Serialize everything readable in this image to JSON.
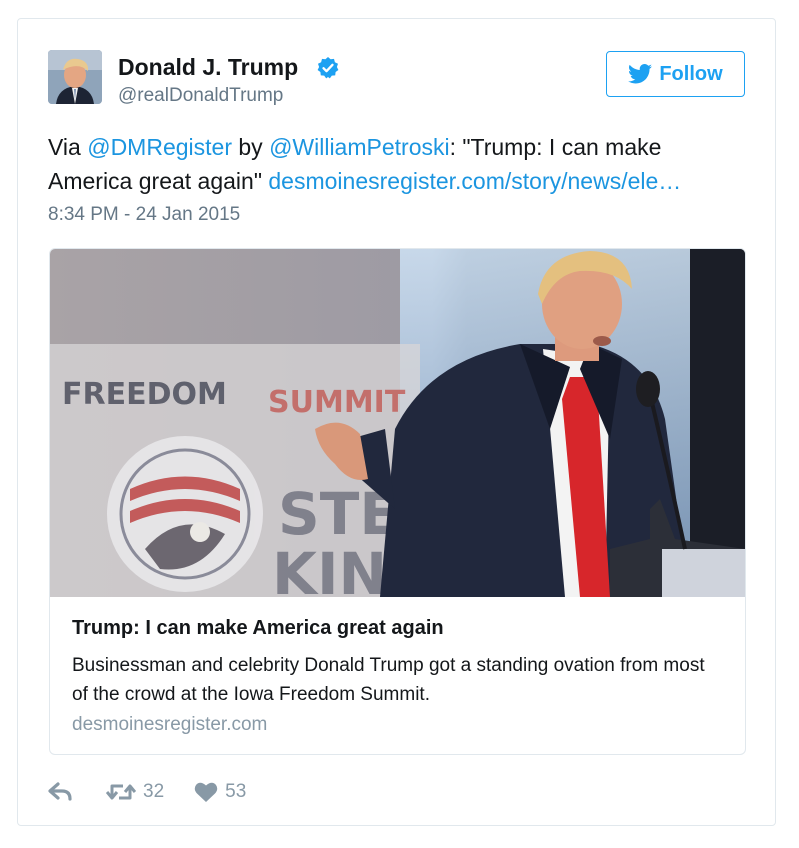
{
  "user": {
    "display_name": "Donald J. Trump",
    "handle": "@realDonaldTrump",
    "verified": true
  },
  "follow_button": {
    "label": "Follow"
  },
  "tweet": {
    "text_prefix": "Via ",
    "mention_1": "@DMRegister",
    "text_mid": " by ",
    "mention_2": "@WilliamPetroski",
    "quote": ": \"Trump: I can make America great again\" ",
    "url": "desmoinesregister.com/story/news/ele…",
    "timestamp": "8:34 PM - 24 Jan 2015"
  },
  "card": {
    "image_text_1": "FREEDOM",
    "image_text_2": "SUMMIT",
    "image_text_3": "STE",
    "image_text_4": "KING",
    "title": "Trump: I can make America great again",
    "description": "Businessman and celebrity Donald Trump got a standing ovation from most of the crowd at the Iowa Freedom Summit.",
    "domain": "desmoinesregister.com"
  },
  "actions": {
    "reply_icon": "reply-icon",
    "retweet_icon": "retweet-icon",
    "retweet_count": "32",
    "like_icon": "heart-icon",
    "like_count": "53"
  },
  "colors": {
    "accent": "#1da1f2",
    "link": "#1b95e0",
    "verified": "#1da1f2",
    "muted": "#657786",
    "tie": "#d7262b"
  }
}
